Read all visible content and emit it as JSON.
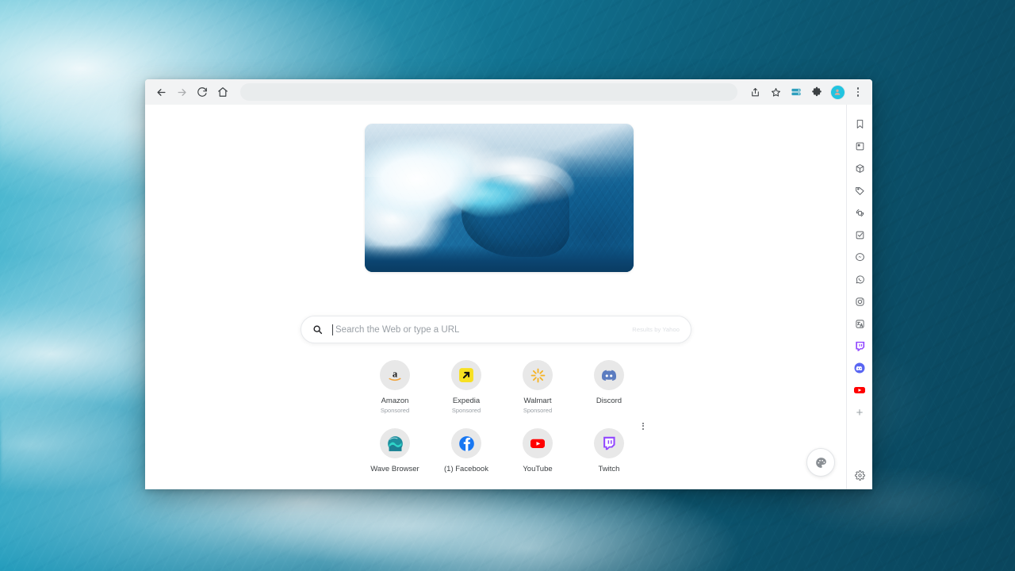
{
  "desktop": {
    "wallpaper_name": "ocean-wave-wallpaper",
    "colors": {
      "foam": "#ffffff",
      "turquoise": "#2ba6c4",
      "deep_teal": "#0a465d"
    }
  },
  "browser": {
    "toolbar": {
      "back_label": "Back",
      "forward_label": "Forward",
      "reload_label": "Reload",
      "home_label": "Home",
      "address_value": "",
      "address_placeholder": "",
      "share_label": "Share",
      "bookmark_label": "Bookmark this tab",
      "wallet_label": "Payment methods",
      "extensions_label": "Extensions",
      "profile_label": "Profile",
      "menu_label": "Customize and control"
    },
    "page": {
      "hero": {
        "name": "ocean-wave-hero-image",
        "alt": "Breaking ocean wave"
      },
      "search": {
        "placeholder": "Search the Web or type a URL",
        "value": "",
        "credit": "Results by Yahoo",
        "icon": "search-icon"
      },
      "shortcuts": [
        {
          "title": "Amazon",
          "subtitle": "Sponsored",
          "icon": "amazon-icon",
          "tile_bg": "#e8e8e8",
          "menu": false
        },
        {
          "title": "Expedia",
          "subtitle": "Sponsored",
          "icon": "expedia-icon",
          "tile_bg": "#e8e8e8",
          "menu": false
        },
        {
          "title": "Walmart",
          "subtitle": "Sponsored",
          "icon": "walmart-icon",
          "tile_bg": "#e8e8e8",
          "menu": false
        },
        {
          "title": "Discord",
          "subtitle": "",
          "icon": "discord-icon",
          "tile_bg": "#e8e8e8",
          "menu": false
        },
        {
          "title": "Wave Browser",
          "subtitle": "",
          "icon": "wave-browser-icon",
          "tile_bg": "#e8e8e8",
          "menu": false
        },
        {
          "title": "(1) Facebook",
          "subtitle": "",
          "icon": "facebook-icon",
          "tile_bg": "#e8e8e8",
          "menu": false
        },
        {
          "title": "YouTube",
          "subtitle": "",
          "icon": "youtube-icon",
          "tile_bg": "#e8e8e8",
          "menu": false
        },
        {
          "title": "Twitch",
          "subtitle": "",
          "icon": "twitch-icon",
          "tile_bg": "#e8e8e8",
          "menu": true
        }
      ],
      "customize_label": "Customize"
    },
    "sidebar": {
      "items": [
        {
          "name": "bookmarks",
          "icon": "bookmark-icon",
          "label": "Bookmarks"
        },
        {
          "name": "reading-list",
          "icon": "reading-list-icon",
          "label": "Reading list"
        },
        {
          "name": "packages",
          "icon": "package-icon",
          "label": "Package tracking"
        },
        {
          "name": "deals",
          "icon": "tag-icon",
          "label": "Deals"
        },
        {
          "name": "phone-sync",
          "icon": "phone-sync-icon",
          "label": "Phone sync"
        },
        {
          "name": "tasks",
          "icon": "checklist-icon",
          "label": "Tasks"
        },
        {
          "name": "messenger",
          "icon": "messenger-icon",
          "label": "Messenger"
        },
        {
          "name": "whatsapp",
          "icon": "whatsapp-icon",
          "label": "WhatsApp"
        },
        {
          "name": "instagram",
          "icon": "instagram-icon",
          "label": "Instagram"
        },
        {
          "name": "translate",
          "icon": "translate-icon",
          "label": "Translate"
        },
        {
          "name": "twitch",
          "icon": "twitch-icon",
          "label": "Twitch"
        },
        {
          "name": "discord",
          "icon": "discord-icon",
          "label": "Discord"
        },
        {
          "name": "youtube",
          "icon": "youtube-icon",
          "label": "YouTube"
        }
      ],
      "add_label": "+",
      "settings_label": "Settings"
    }
  }
}
